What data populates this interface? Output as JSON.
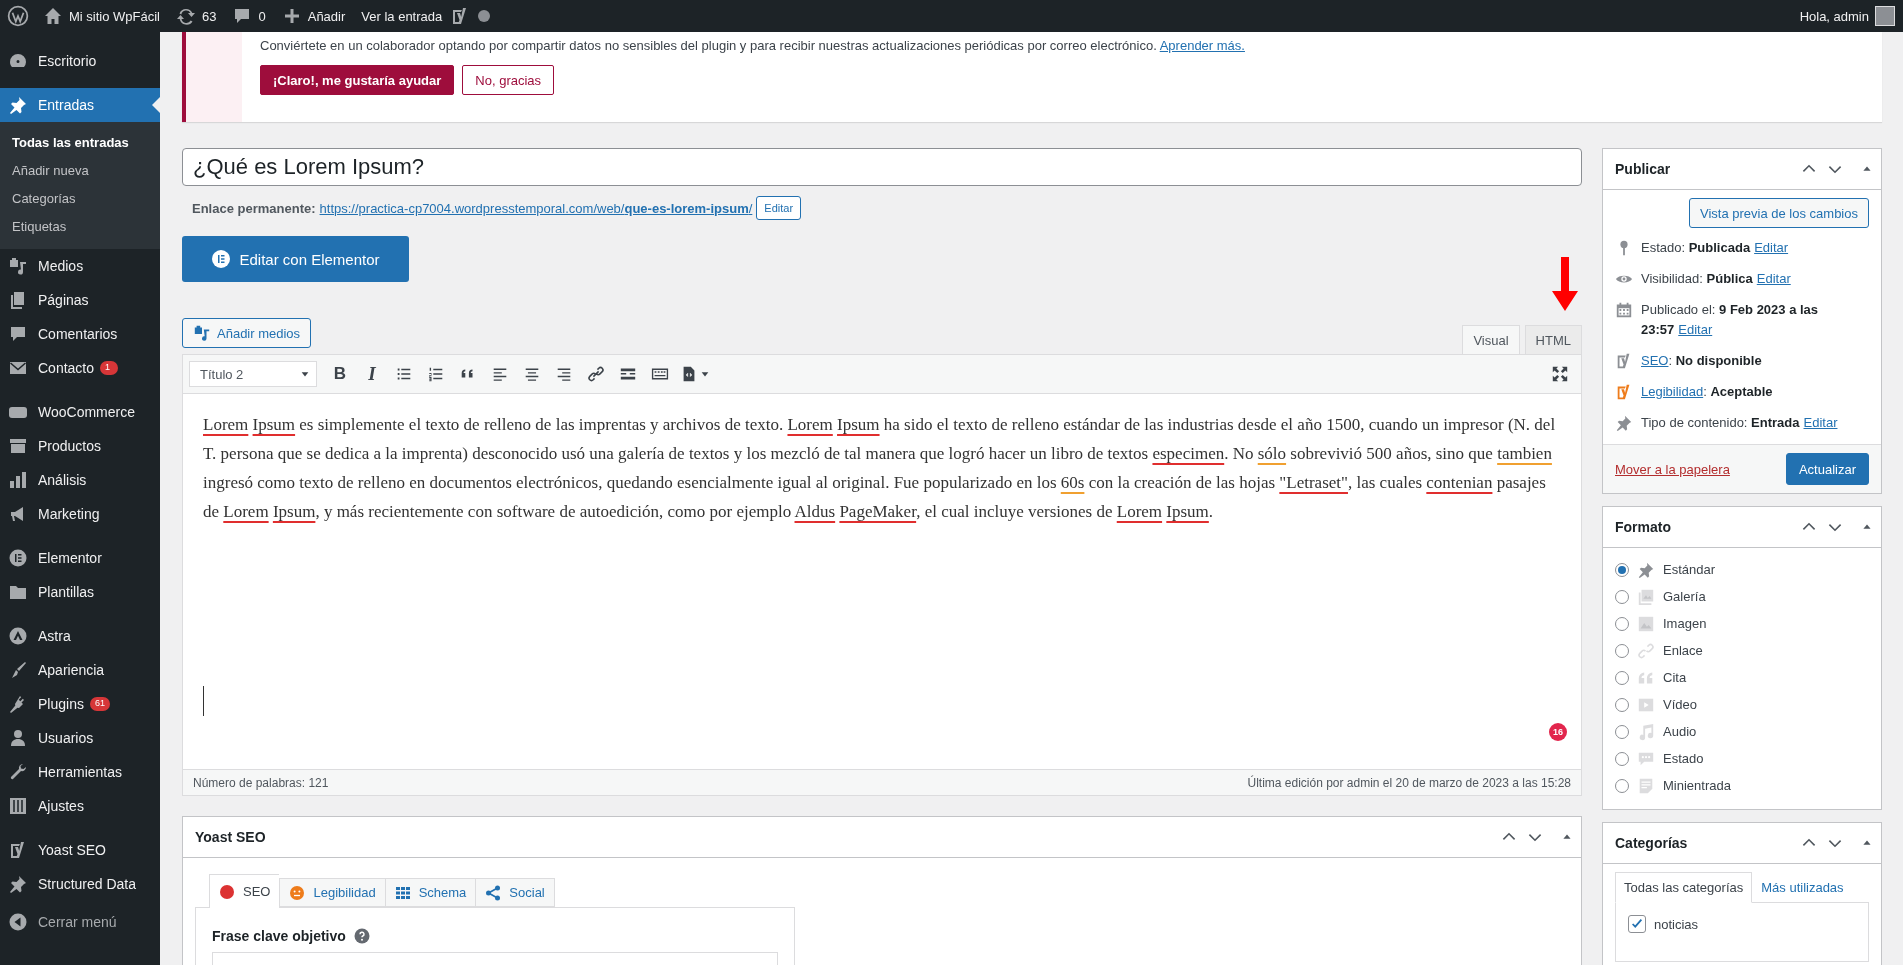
{
  "admin_bar": {
    "site_name": "Mi sitio WpFácil",
    "updates": "63",
    "comments": "0",
    "new": "Añadir",
    "view": "Ver la entrada",
    "greeting": "Hola, admin"
  },
  "sidebar": {
    "groups": [
      {
        "items": [
          {
            "label": "Escritorio",
            "current": false
          }
        ]
      },
      {
        "items": [
          {
            "label": "Entradas",
            "current": true,
            "submenu": [
              {
                "label": "Todas las entradas",
                "current": true
              },
              {
                "label": "Añadir nueva",
                "current": false
              },
              {
                "label": "Categorías",
                "current": false
              },
              {
                "label": "Etiquetas",
                "current": false
              }
            ]
          },
          {
            "label": "Medios",
            "current": false
          },
          {
            "label": "Páginas",
            "current": false
          },
          {
            "label": "Comentarios",
            "current": false
          },
          {
            "label": "Contacto",
            "current": false,
            "badge": "1"
          }
        ]
      },
      {
        "items": [
          {
            "label": "WooCommerce",
            "current": false
          },
          {
            "label": "Productos",
            "current": false
          },
          {
            "label": "Análisis",
            "current": false
          },
          {
            "label": "Marketing",
            "current": false
          }
        ]
      },
      {
        "items": [
          {
            "label": "Elementor",
            "current": false
          },
          {
            "label": "Plantillas",
            "current": false
          }
        ]
      },
      {
        "items": [
          {
            "label": "Astra",
            "current": false
          },
          {
            "label": "Apariencia",
            "current": false
          },
          {
            "label": "Plugins",
            "current": false,
            "badge": "61"
          },
          {
            "label": "Usuarios",
            "current": false
          },
          {
            "label": "Herramientas",
            "current": false
          },
          {
            "label": "Ajustes",
            "current": false
          }
        ]
      },
      {
        "items": [
          {
            "label": "Yoast SEO",
            "current": false
          },
          {
            "label": "Structured Data",
            "current": false
          }
        ]
      }
    ],
    "collapse": "Cerrar menú"
  },
  "notice": {
    "text": "Conviértete en un colaborador optando por compartir datos no sensibles del plugin y para recibir nuestras actualizaciones periódicas por correo electrónico.",
    "link": "Aprender más.",
    "buttons": [
      {
        "label": "¡Claro!, me gustaría ayudar",
        "kind": "primary"
      },
      {
        "label": "No, gracias",
        "kind": "secondary"
      }
    ]
  },
  "post": {
    "title": "¿Qué es Lorem Ipsum?",
    "permalink_label": "Enlace permanente:",
    "permalink": "https://practica-cp7004.wordpresstemporal.com/web/**que-es-lorem-ipsum**/",
    "permalink_button": "Editar",
    "elementor_button": "Editar con Elementor"
  },
  "editor": {
    "add_media": "Añadir medios",
    "tabs": [
      {
        "label": "Visual",
        "selected": true
      },
      {
        "label": "HTML",
        "selected": false
      }
    ],
    "format": "Título 2",
    "glyph_buttons": [
      "B",
      "I"
    ],
    "content": [
      {
        "text": "Lorem Ipsum",
        "kind": "spelling"
      },
      {
        "text": " es simplemente el texto de relleno de las imprentas y archivos de texto. "
      },
      {
        "text": "Lorem Ipsum",
        "kind": "spelling"
      },
      {
        "text": " ha sido el texto de relleno estándar de las industrias desde el año 1500, cuando un impresor (N. del T. persona que se dedica a la imprenta) desconocido usó una galería de textos y los mezcló de tal manera que logró hacer un libro de textos "
      },
      {
        "text": "especimen",
        "kind": "spelling"
      },
      {
        "text": ". No "
      },
      {
        "text": "sólo",
        "kind": "grammar"
      },
      {
        "text": " sobrevivió 500 años, sino que "
      },
      {
        "text": "tambien",
        "kind": "grammar"
      },
      {
        "text": " ingresó como texto de relleno en documentos electrónicos, quedando esencialmente igual al original. Fue popularizado en los "
      },
      {
        "text": "60s",
        "kind": "grammar"
      },
      {
        "text": " con la creación de las hojas "
      },
      {
        "text": "\"Letraset\"",
        "kind": "spelling"
      },
      {
        "text": ", las cuales "
      },
      {
        "text": "contenian",
        "kind": "spelling"
      },
      {
        "text": " pasajes de "
      },
      {
        "text": "Lorem Ipsum",
        "kind": "spelling"
      },
      {
        "text": ", y más recientemente con software de autoedición, como por ejemplo "
      },
      {
        "text": "Aldus PageMaker",
        "kind": "spelling"
      },
      {
        "text": ", el cual incluye versiones de "
      },
      {
        "text": "Lorem Ipsum",
        "kind": "spelling"
      },
      {
        "text": "."
      }
    ],
    "issue_count": "16",
    "word_count": "Número de palabras: 121",
    "last_edit": "Última edición por admin el 20 de marzo de 2023 a las 15:28"
  },
  "yoast": {
    "title": "Yoast SEO",
    "tabs": [
      {
        "label": "SEO",
        "kind": "score",
        "color": "#dc3232",
        "selected": true
      },
      {
        "label": "Legibilidad",
        "kind": "readability",
        "color": "#ee7c1b",
        "selected": false
      },
      {
        "label": "Schema",
        "kind": "schema",
        "selected": false
      },
      {
        "label": "Social",
        "kind": "social",
        "selected": false
      }
    ],
    "keyphrase_label": "Frase clave objetivo"
  },
  "publish": {
    "title": "Publicar",
    "preview": "Vista previa de los cambios",
    "rows": [
      {
        "kind": "status",
        "text": "Estado: **Publicada**",
        "link": "Editar"
      },
      {
        "kind": "visibility",
        "text": "Visibilidad: **Pública**",
        "link": "Editar"
      },
      {
        "kind": "date",
        "text": "Publicado el: **9 Feb 2023 a las 23:57**",
        "link": "Editar"
      },
      {
        "kind": "seo",
        "link": "SEO",
        "text": ": **No disponible**"
      },
      {
        "kind": "readability",
        "link": "Legibilidad",
        "text": ": **Aceptable**"
      },
      {
        "kind": "type",
        "text": "Tipo de contenido: **Entrada**",
        "link": "Editar"
      }
    ],
    "trash": "Mover a la papelera",
    "update": "Actualizar"
  },
  "format": {
    "title": "Formato",
    "options": [
      {
        "label": "Estándar",
        "selected": true
      },
      {
        "label": "Galería",
        "selected": false
      },
      {
        "label": "Imagen",
        "selected": false
      },
      {
        "label": "Enlace",
        "selected": false
      },
      {
        "label": "Cita",
        "selected": false
      },
      {
        "label": "Vídeo",
        "selected": false
      },
      {
        "label": "Audio",
        "selected": false
      },
      {
        "label": "Estado",
        "selected": false
      },
      {
        "label": "Minientrada",
        "selected": false
      }
    ]
  },
  "categories": {
    "title": "Categorías",
    "tabs": [
      {
        "label": "Todas las categorías",
        "selected": true
      },
      {
        "label": "Más utilizadas",
        "selected": false
      }
    ],
    "items": [
      {
        "label": "noticias",
        "checked": true
      }
    ]
  }
}
